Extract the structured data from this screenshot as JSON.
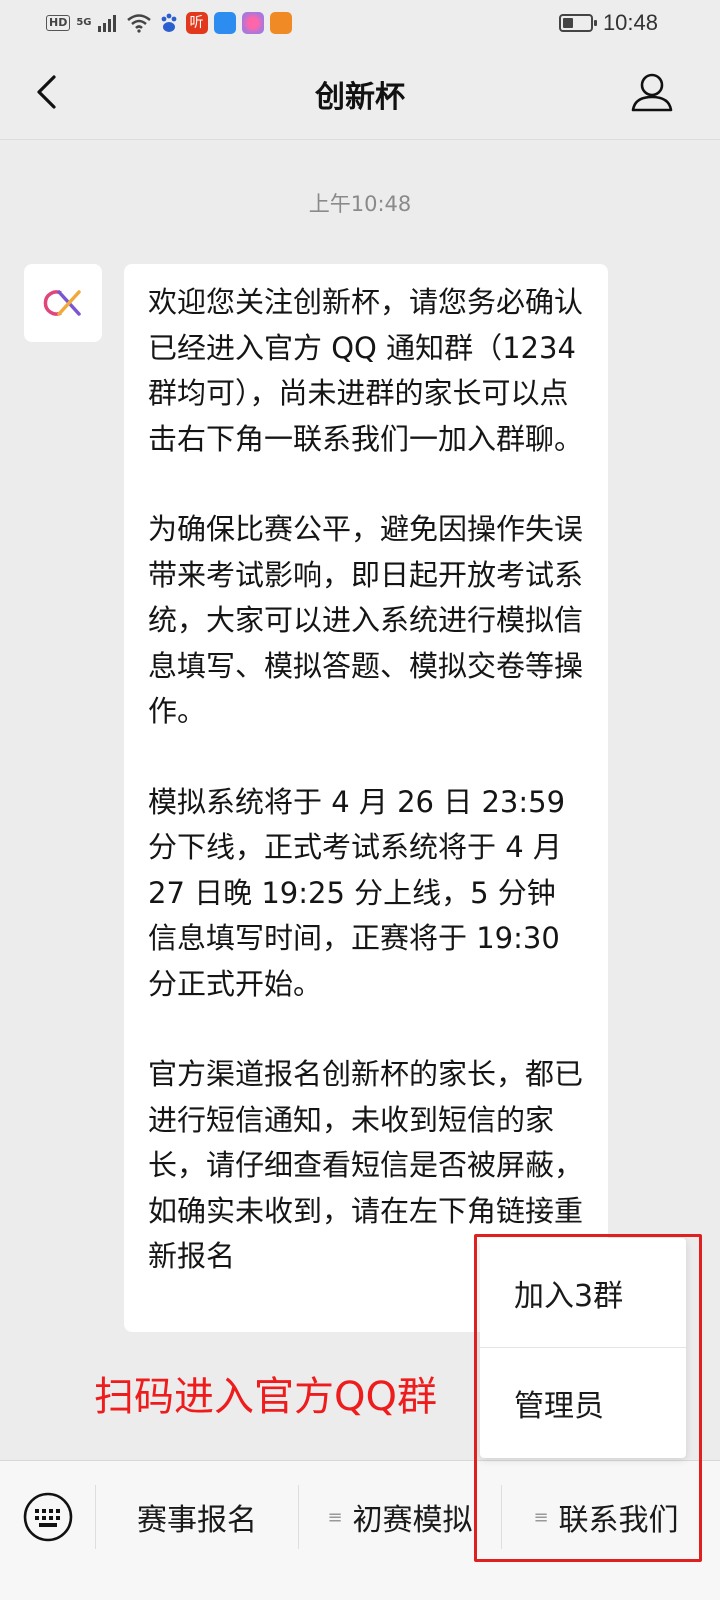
{
  "status_bar": {
    "time": "10:48",
    "hd_label": "HD",
    "network_label": "5G",
    "app_listen_label": "听",
    "battery_level": 0.4
  },
  "nav": {
    "title": "创新杯"
  },
  "chat": {
    "timestamp": "上午10:48",
    "message_paragraphs": [
      "欢迎您关注创新杯，请您务必确认已经进入官方 QQ 通知群（1234 群均可），尚未进群的家长可以点击右下角一联系我们一加入群聊。",
      "为确保比赛公平，避免因操作失误带来考试影响，即日起开放考试系统，大家可以进入系统进行模拟信息填写、模拟答题、模拟交卷等操作。",
      "模拟系统将于 4 月 26 日 23:59 分下线，正式考试系统将于 4 月 27 日晚 19:25 分上线，5 分钟信息填写时间，正赛将于 19:30 分正式开始。",
      "官方渠道报名创新杯的家长，都已进行短信通知，未收到短信的家长，请仔细查看短信是否被屏蔽，如确实未收到，请在左下角链接重新报名"
    ]
  },
  "overlay": {
    "qr_caption": "扫码进入官方QQ群",
    "caption_color": "#ee1c1c",
    "highlight_color": "#e02020"
  },
  "bottom_menu": {
    "items": [
      {
        "label": "赛事报名",
        "has_submenu": false
      },
      {
        "label": "初赛模拟",
        "has_submenu": true
      },
      {
        "label": "联系我们",
        "has_submenu": true
      }
    ],
    "submenu_lines_glyph": "≡"
  },
  "popup_menu": {
    "items": [
      {
        "label": "加入3群"
      },
      {
        "label": "管理员"
      }
    ]
  }
}
